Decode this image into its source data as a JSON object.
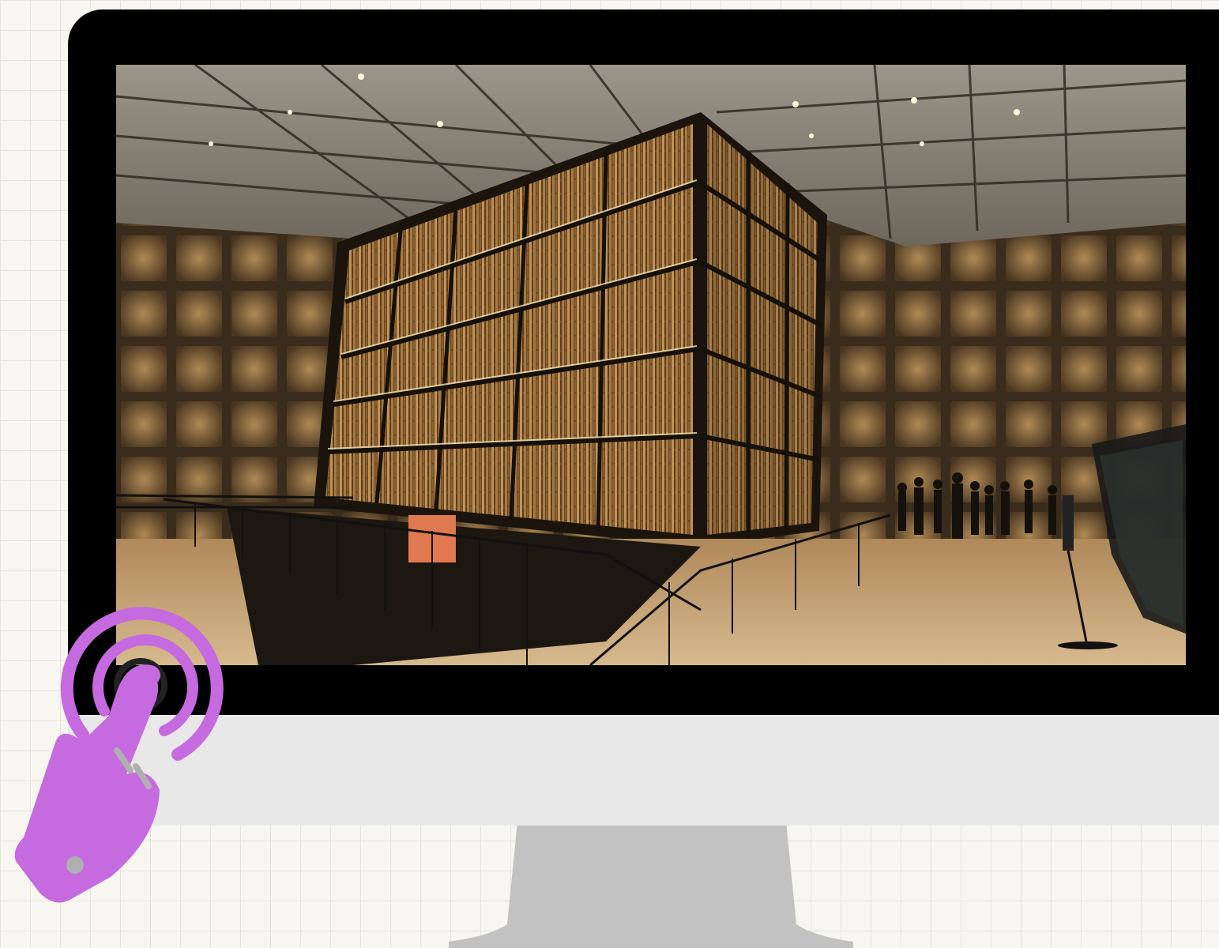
{
  "scene": {
    "subject": "",
    "sign_text": ""
  },
  "colors": {
    "background": "#f7f6f0",
    "grid": "#e4e3dc",
    "bezel": "#000000",
    "chin": "#e8e8e8",
    "stand": "#c2c2c2",
    "touch_icon": "#c66ae0",
    "finger_detail": "#b0b0b0"
  },
  "icons": {
    "touch": "tap-gesture-icon"
  }
}
